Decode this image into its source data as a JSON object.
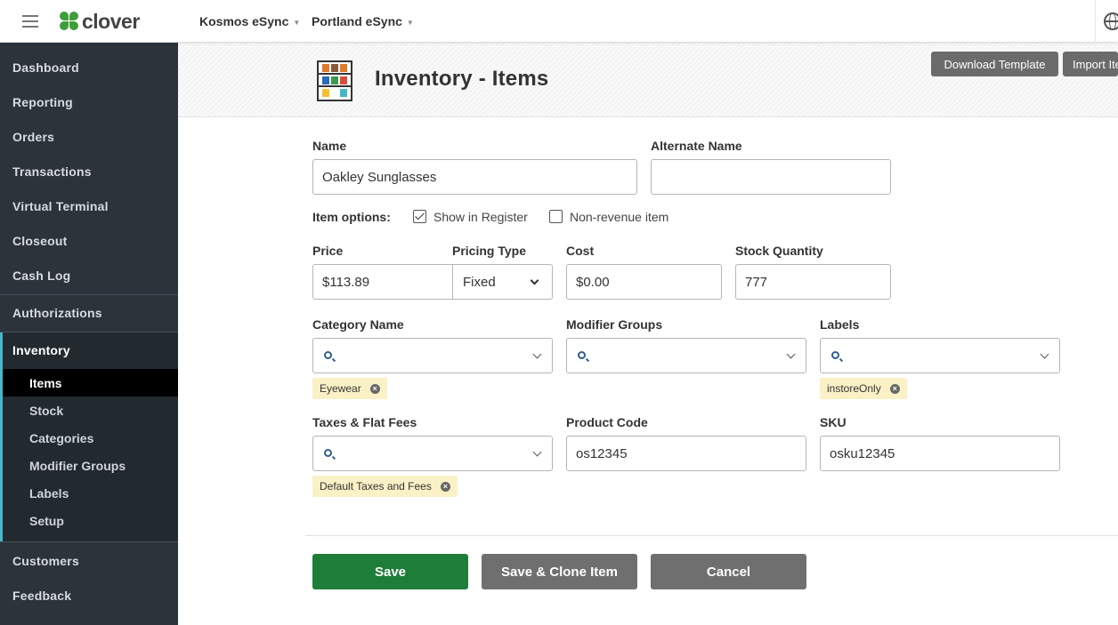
{
  "topbar": {
    "logo_text": "clover",
    "merchant_primary": "Kosmos eSync",
    "merchant_secondary": "Portland eSync"
  },
  "sidebar": {
    "items": [
      "Dashboard",
      "Reporting",
      "Orders",
      "Transactions",
      "Virtual Terminal",
      "Closeout",
      "Cash Log",
      "Authorizations",
      "Inventory",
      "Customers",
      "Feedback"
    ],
    "inventory_sub": [
      "Items",
      "Stock",
      "Categories",
      "Modifier Groups",
      "Labels",
      "Setup"
    ],
    "active_sub": "Items",
    "accent_color": "#47b6c8"
  },
  "header": {
    "title": "Inventory - Items",
    "download_template_label": "Download Template",
    "import_label": "Import Items"
  },
  "form": {
    "name_label": "Name",
    "name_value": "Oakley Sunglasses",
    "alt_name_label": "Alternate Name",
    "alt_name_value": "",
    "item_options_label": "Item options:",
    "show_in_register_label": "Show in Register",
    "show_in_register_checked": true,
    "non_revenue_label": "Non-revenue item",
    "non_revenue_checked": false,
    "price_label": "Price",
    "price_value": "$113.89",
    "pricing_type_label": "Pricing Type",
    "pricing_type_value": "Fixed",
    "cost_label": "Cost",
    "cost_value": "$0.00",
    "stock_label": "Stock Quantity",
    "stock_value": "777",
    "category_label": "Category Name",
    "category_tag": "Eyewear",
    "modifier_label": "Modifier Groups",
    "labels_label": "Labels",
    "labels_tag": "instoreOnly",
    "taxes_label": "Taxes & Flat Fees",
    "taxes_tag": "Default Taxes and Fees",
    "product_code_label": "Product Code",
    "product_code_value": "os12345",
    "sku_label": "SKU",
    "sku_value": "osku12345"
  },
  "actions": {
    "save_label": "Save",
    "save_clone_label": "Save & Clone Item",
    "cancel_label": "Cancel",
    "save_color": "#1f7d3a",
    "secondary_color": "#6f6f6f"
  }
}
